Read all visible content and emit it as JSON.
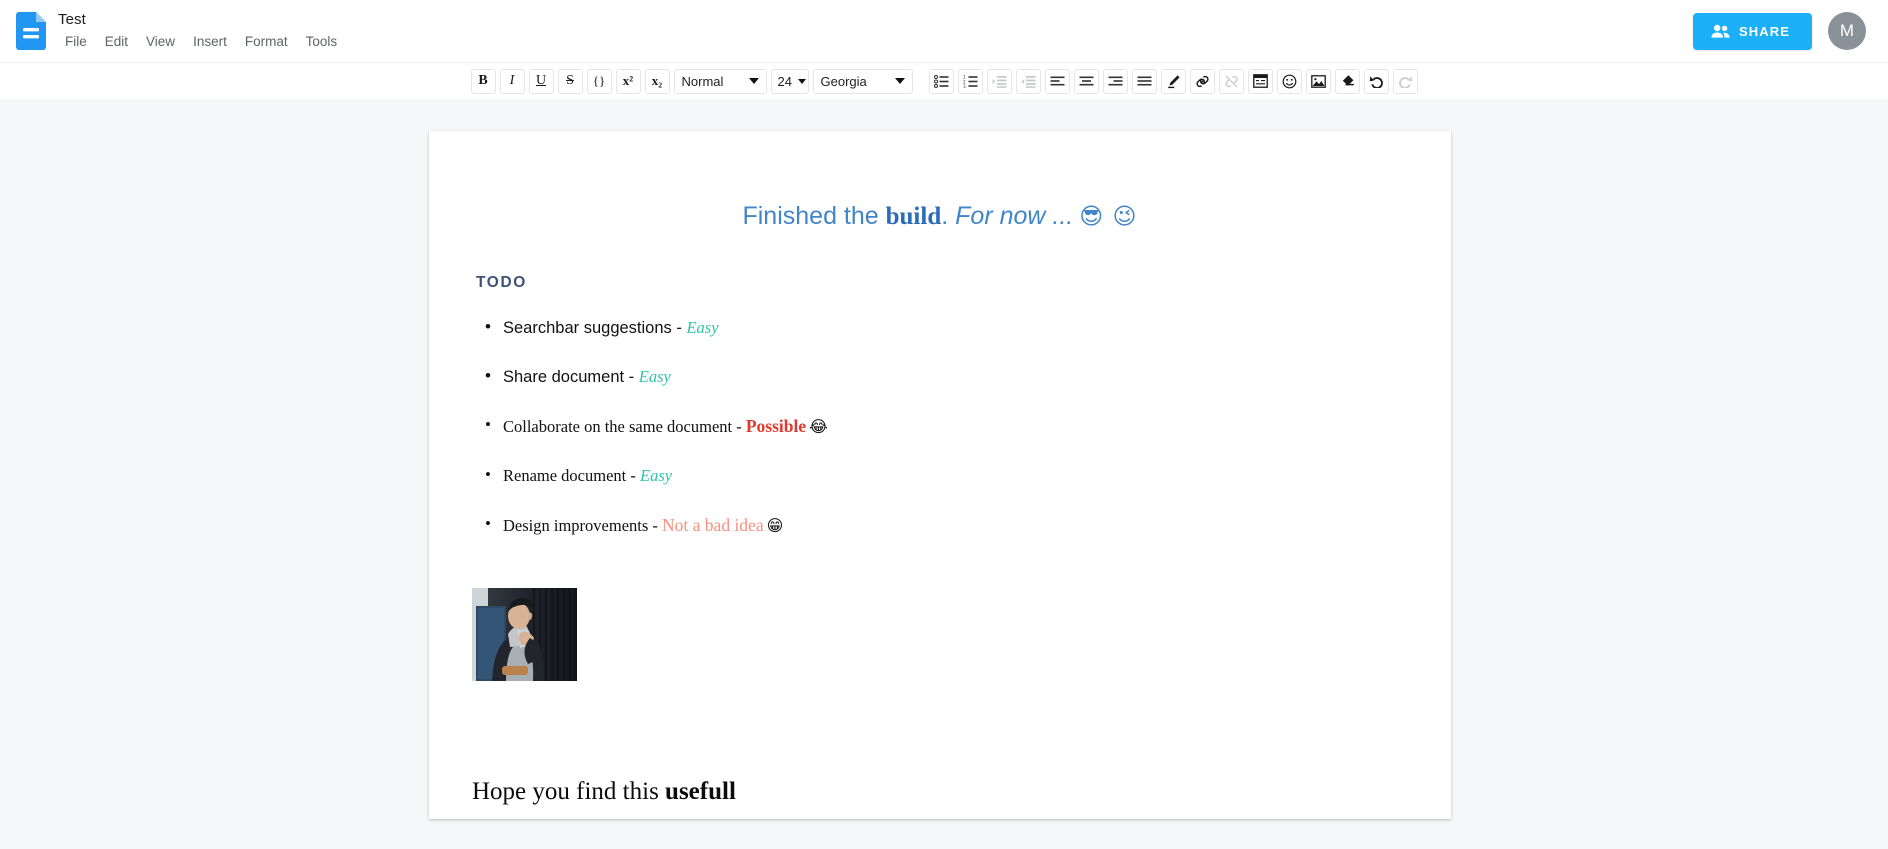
{
  "header": {
    "doc_title": "Test",
    "doc_icon": "document-icon",
    "menus": [
      {
        "label": "File"
      },
      {
        "label": "Edit"
      },
      {
        "label": "View"
      },
      {
        "label": "Insert"
      },
      {
        "label": "Format"
      },
      {
        "label": "Tools"
      }
    ],
    "share_label": "SHARE",
    "share_icon": "people-icon",
    "share_color": "#1bb0f7",
    "avatar_initial": "M",
    "avatar_color": "#8a9199"
  },
  "toolbar": {
    "bold": "B",
    "italic": "I",
    "underline": "U",
    "strikethrough": "S",
    "code": "{}",
    "superscript": "x²",
    "subscript": "x₂",
    "paragraph_style": "Normal",
    "font_size": "24",
    "font_family": "Georgia",
    "buttons": [
      {
        "name": "bulleted-list-icon"
      },
      {
        "name": "numbered-list-icon"
      },
      {
        "name": "indent-increase-icon"
      },
      {
        "name": "indent-decrease-icon"
      },
      {
        "name": "align-left-icon"
      },
      {
        "name": "align-center-icon"
      },
      {
        "name": "align-right-icon"
      },
      {
        "name": "align-justify-icon"
      },
      {
        "name": "highlight-pen-icon"
      },
      {
        "name": "link-icon"
      },
      {
        "name": "unlink-icon"
      },
      {
        "name": "insert-table-icon"
      },
      {
        "name": "emoji-icon"
      },
      {
        "name": "insert-image-icon"
      },
      {
        "name": "clear-format-eraser-icon"
      },
      {
        "name": "undo-icon"
      },
      {
        "name": "redo-icon"
      }
    ]
  },
  "document": {
    "heading": {
      "part1": "Finished the ",
      "bold": "build",
      "part2": ". ",
      "italic": "For now ...",
      "emoji": "😎 😉"
    },
    "section_title": "TODO",
    "todo_items": [
      {
        "text": "Searchbar suggestions",
        "dash": " - ",
        "tag": "Easy",
        "tag_kind": "easy",
        "emoji": "",
        "style": "sans",
        "muted": false
      },
      {
        "text": "Share document",
        "dash": " - ",
        "tag": "Easy",
        "tag_kind": "easy",
        "emoji": "",
        "style": "sans",
        "muted": false
      },
      {
        "text": "Collaborate on the same document",
        "dash": " - ",
        "tag": "Possible",
        "tag_kind": "possible",
        "emoji": "😂",
        "style": "serif",
        "muted": false
      },
      {
        "text": "Rename document",
        "dash": " - ",
        "tag": "Easy",
        "tag_kind": "easy",
        "emoji": "",
        "style": "serif",
        "muted": true
      },
      {
        "text": "Design improvements",
        "dash": " - ",
        "tag": "Not a bad idea",
        "tag_kind": "notbad",
        "emoji": "😁",
        "style": "serif",
        "muted": false
      }
    ],
    "image_alt": "photo-of-seated-person",
    "closing": {
      "text": "Hope you find this ",
      "bold": "usefull"
    }
  }
}
